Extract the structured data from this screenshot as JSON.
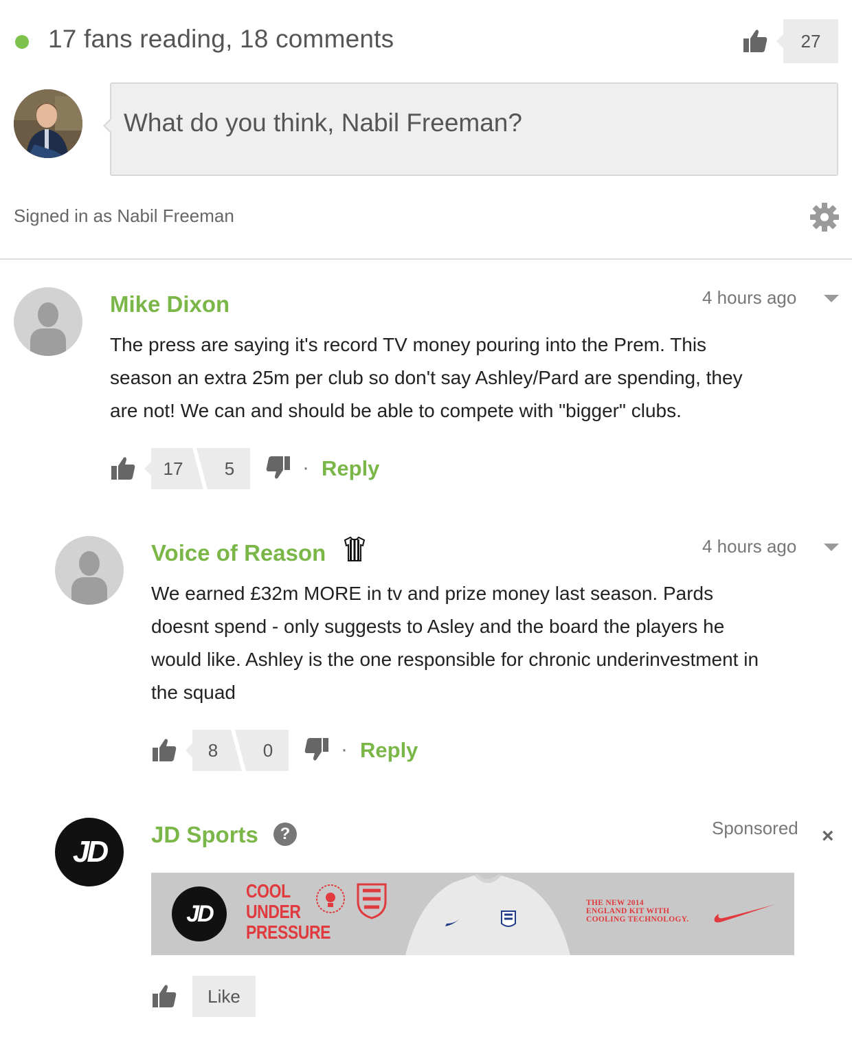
{
  "header": {
    "reading_text": "17 fans reading, 18 comments",
    "like_count": "27",
    "status_color": "#7ec24e"
  },
  "composer": {
    "placeholder": "What do you think, Nabil Freeman?",
    "signed_in_text": "Signed in as Nabil Freeman",
    "settings_icon": "gear-icon"
  },
  "comments": [
    {
      "author": "Mike Dixon",
      "time": "4 hours ago",
      "lines": [
        "The press are saying it's record TV money pouring into the Prem. This",
        "season an extra 25m per club so don't say Ashley/Pard are spending, they",
        "are not! We can and should be able to compete with \"bigger\" clubs."
      ],
      "upvotes": "17",
      "downvotes": "5",
      "reply_label": "Reply"
    },
    {
      "author": "Voice of Reason",
      "time": "4 hours ago",
      "badge_icon": "striped-shirt-icon",
      "lines": [
        "We earned £32m MORE in tv and prize money last season. Pards",
        "doesnt spend - only suggests to Asley and the board the players he",
        "would like. Ashley is the one responsible for chronic underinvestment in",
        "the squad"
      ],
      "upvotes": "8",
      "downvotes": "0",
      "reply_label": "Reply"
    }
  ],
  "sponsored": {
    "advertiser": "JD Sports",
    "logo_text": "JD",
    "label": "Sponsored",
    "close_glyph": "×",
    "help_glyph": "?",
    "banner": {
      "headline": [
        "COOL",
        "UNDER",
        "PRESSURE"
      ],
      "tagline": [
        "THE NEW 2014",
        "ENGLAND KIT WITH",
        "COOLING TECHNOLOGY."
      ]
    },
    "like_label": "Like"
  },
  "colors": {
    "accent_green": "#7ab648",
    "banner_red": "#e03a3e",
    "box_grey": "#ebebeb"
  }
}
